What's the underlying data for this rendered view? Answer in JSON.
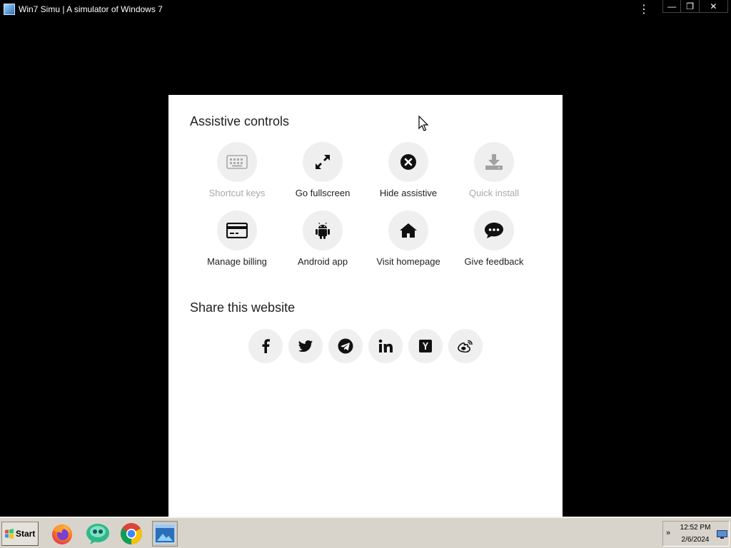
{
  "window": {
    "title": "Win7 Simu | A simulator of Windows 7",
    "menu_glyph": "⋮",
    "controls": {
      "minimize": "—",
      "restore": "❐",
      "close": "✕"
    }
  },
  "assistive": {
    "title": "Assistive controls",
    "items": [
      {
        "label": "Shortcut keys",
        "icon": "keyboard-icon",
        "enabled": false
      },
      {
        "label": "Go fullscreen",
        "icon": "expand-arrows-icon",
        "enabled": true
      },
      {
        "label": "Hide assistive",
        "icon": "close-circle-icon",
        "enabled": true
      },
      {
        "label": "Quick install",
        "icon": "download-icon",
        "enabled": false
      },
      {
        "label": "Manage billing",
        "icon": "credit-card-icon",
        "enabled": true
      },
      {
        "label": "Android app",
        "icon": "android-icon",
        "enabled": true
      },
      {
        "label": "Visit homepage",
        "icon": "home-icon",
        "enabled": true
      },
      {
        "label": "Give feedback",
        "icon": "chat-bubble-icon",
        "enabled": true
      }
    ]
  },
  "share": {
    "title": "Share this website",
    "networks": [
      {
        "name": "facebook",
        "icon": "facebook-icon",
        "glyph": "f"
      },
      {
        "name": "twitter",
        "icon": "twitter-icon"
      },
      {
        "name": "telegram",
        "icon": "telegram-icon"
      },
      {
        "name": "linkedin",
        "icon": "linkedin-icon",
        "glyph": "in"
      },
      {
        "name": "hacker-news",
        "icon": "y-combinator-icon",
        "glyph": "Y"
      },
      {
        "name": "weibo",
        "icon": "weibo-icon"
      }
    ]
  },
  "taskbar": {
    "start_label": "Start",
    "apps": [
      {
        "name": "firefox",
        "icon": "firefox-icon"
      },
      {
        "name": "messenger",
        "icon": "messenger-icon"
      },
      {
        "name": "chrome",
        "icon": "chrome-icon"
      },
      {
        "name": "win7-simu",
        "icon": "window-app-icon",
        "active": true
      }
    ],
    "tray": {
      "arrow": "»",
      "time": "12:52 PM",
      "date": "2/6/2024"
    }
  },
  "colors": {
    "desktop_bg": "#000000",
    "panel_bg": "#ffffff",
    "tile_bg": "#efefef",
    "disabled_text": "#a9a9a9",
    "taskbar_bg": "#d8d4cc"
  }
}
